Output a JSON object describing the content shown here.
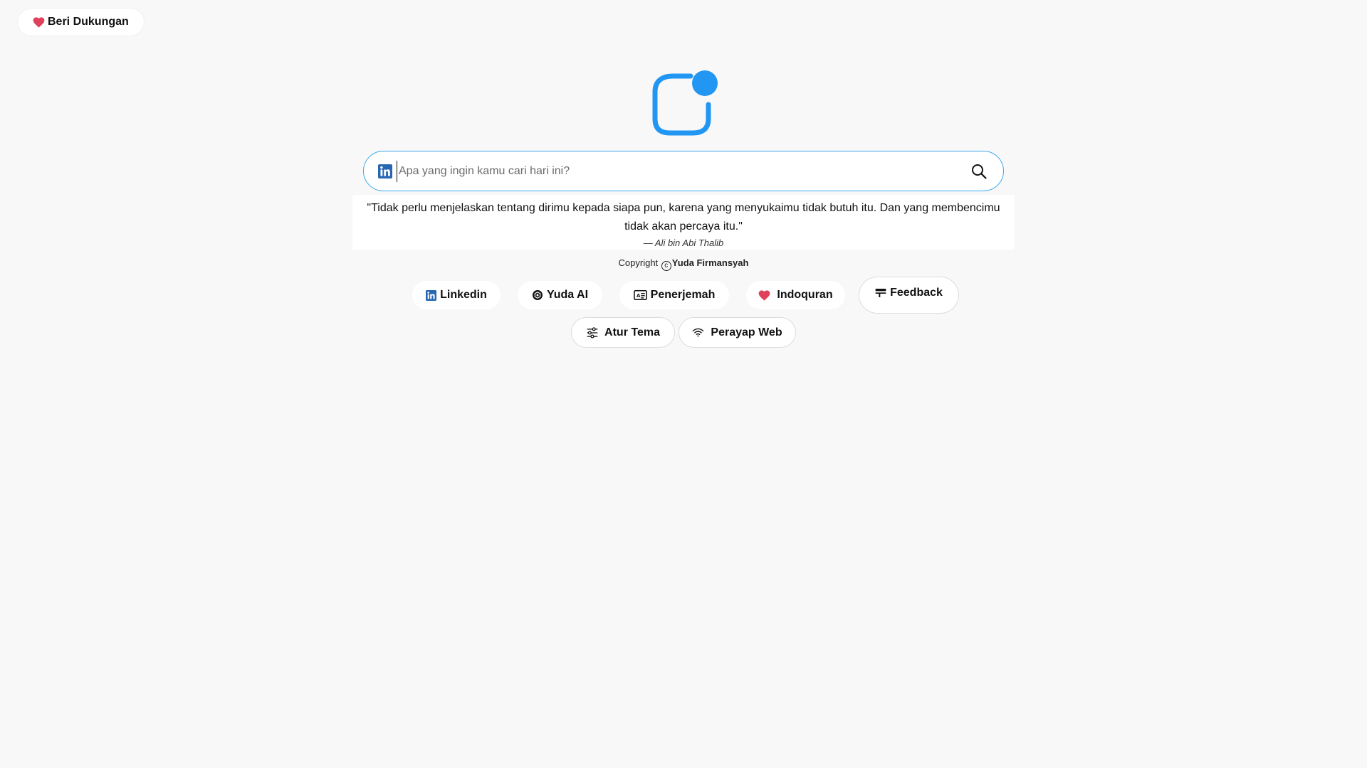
{
  "support": {
    "label": "Beri Dukungan",
    "icon": "heart-icon",
    "icon_color": "#e0415a"
  },
  "logo": {
    "icon": "app-logo",
    "color": "#2196f3"
  },
  "search": {
    "placeholder": "Apa yang ingin kamu cari hari ini?",
    "value": "",
    "engine_icon": "linkedin-icon",
    "border_color": "#3ba7ee"
  },
  "quote": {
    "text": "\"Tidak perlu menjelaskan tentang dirimu kepada siapa pun, karena yang menyukaimu tidak butuh itu. Dan yang membencimu tidak akan percaya itu.\"",
    "author": "— Ali bin Abi Thalib"
  },
  "copyright": {
    "prefix": "Copyright",
    "owner": "Yuda Firmansyah"
  },
  "links": [
    {
      "label": "Linkedin",
      "icon": "linkedin-icon"
    },
    {
      "label": "Yuda AI",
      "icon": "openai-icon"
    },
    {
      "label": "Penerjemah",
      "icon": "translate-card-icon"
    },
    {
      "label": "Indoquran",
      "icon": "heart-icon"
    },
    {
      "label": "Feedback",
      "icon": "feedback-icon"
    },
    {
      "label": "Atur Tema",
      "icon": "sliders-icon"
    },
    {
      "label": "Perayap Web",
      "icon": "wifi-icon"
    }
  ]
}
